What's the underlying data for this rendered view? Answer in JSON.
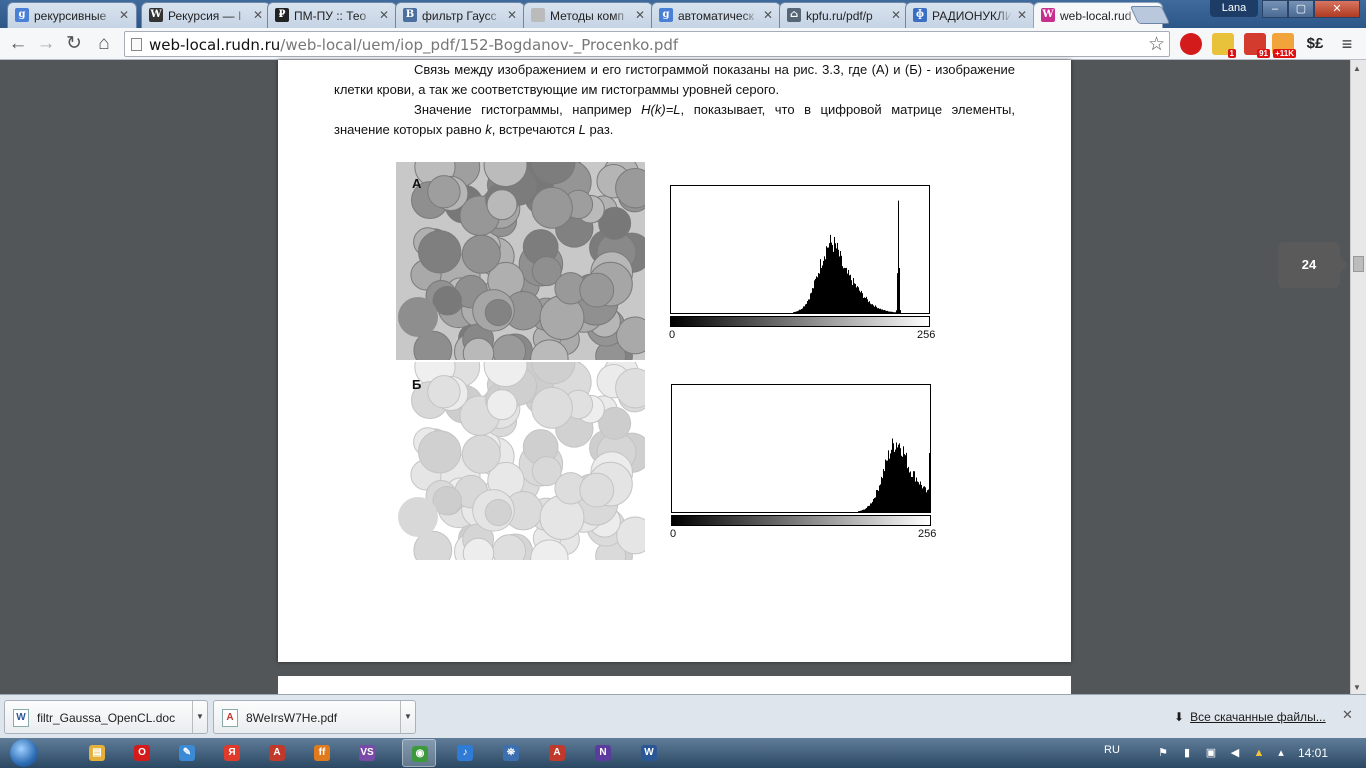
{
  "tabs": [
    {
      "title": "рекурсивные",
      "icon": "google-icon",
      "icon_text": "g",
      "color": "#4a7fd6"
    },
    {
      "title": "Рекурсия — I",
      "icon": "wikipedia-icon",
      "icon_text": "W",
      "color": "#333333"
    },
    {
      "title": "ПМ-ПУ :: Тео",
      "icon": "pmpu-icon",
      "icon_text": "₽",
      "color": "#222222"
    },
    {
      "title": "фильтр Гаусс",
      "icon": "vk-icon",
      "icon_text": "B",
      "color": "#4b6f9e"
    },
    {
      "title": "Методы комп",
      "icon": "page-icon",
      "icon_text": "",
      "color": "#bbbbbb"
    },
    {
      "title": "автоматическ",
      "icon": "google-icon",
      "icon_text": "g",
      "color": "#4a7fd6"
    },
    {
      "title": "kpfu.ru/pdf/p",
      "icon": "university-icon",
      "icon_text": "⌂",
      "color": "#556677"
    },
    {
      "title": "РАДИОНУКЛИ",
      "icon": "phi-icon",
      "icon_text": "ɸ",
      "color": "#3a6fc4"
    },
    {
      "title": "web-local.rud",
      "icon": "rudn-icon",
      "icon_text": "W",
      "color": "#c72f8e"
    }
  ],
  "window": {
    "user": "Lana",
    "minimize": "–",
    "maximize": "▢",
    "close": "✕"
  },
  "toolbar": {
    "back": "←",
    "forward": "→",
    "reload": "↻",
    "home": "⌂",
    "url_host": "web-local.rudn.ru",
    "url_path": "/web-local/uem/iop_pdf/152-Bogdanov-_Procenko.pdf",
    "star": "☆",
    "ext_badges": [
      "1",
      "91",
      "+11K"
    ],
    "ext_currency": "$£",
    "menu": "≡"
  },
  "document": {
    "para1": "Связь между изображением и его гистограммой показаны на рис. 3.3, где (А) и (Б) - изображение клетки крови, а так же соответствующие им гистограммы уровней серого.",
    "para2_a": "Значение гистограммы, например ",
    "para2_hk": "H(k)=L",
    "para2_b": ", показывает, что в цифровой матрице элементы, значение которых равно ",
    "para2_k": "k",
    "para2_c": ", встречаются ",
    "para2_l": "L",
    "para2_d": " раз.",
    "label_a": "А",
    "label_b": "Б",
    "hist_a_min": "0",
    "hist_a_max": "256",
    "hist_b_min": "0",
    "hist_b_max": "256"
  },
  "histograms": {
    "a": {
      "peak_main": 0.62,
      "peak_spike": 0.88
    },
    "b": {
      "peak_main": 0.87,
      "peak_spike": 1.0
    }
  },
  "page_indicator": "24",
  "downloads": {
    "items": [
      {
        "name": "filtr_Gaussa_OpenCL.doc",
        "icon_text": "W",
        "color": "#2b5797"
      },
      {
        "name": "8WeIrsW7He.pdf",
        "icon_text": "A",
        "color": "#c0392b"
      }
    ],
    "all_label": "Все скачанные файлы...",
    "close": "✕"
  },
  "taskbar": {
    "items": [
      {
        "name": "explorer",
        "icon_text": "▤",
        "color": "#e5b03a"
      },
      {
        "name": "opera",
        "icon_text": "O",
        "color": "#d31b1b"
      },
      {
        "name": "paint",
        "icon_text": "✎",
        "color": "#3c8ad6"
      },
      {
        "name": "yandex",
        "icon_text": "Я",
        "color": "#e03a2a"
      },
      {
        "name": "acrobat",
        "icon_text": "A",
        "color": "#c0392b"
      },
      {
        "name": "firefox",
        "icon_text": "ff",
        "color": "#e07a1e"
      },
      {
        "name": "visualstudio",
        "icon_text": "VS",
        "color": "#7a4aa8"
      },
      {
        "name": "chrome",
        "icon_text": "◉",
        "color": "#3c9a3c"
      },
      {
        "name": "itunes",
        "icon_text": "♪",
        "color": "#2f7bd6"
      },
      {
        "name": "maps",
        "icon_text": "⛯",
        "color": "#3c6fb0"
      },
      {
        "name": "pdf-reader",
        "icon_text": "A",
        "color": "#c0392b"
      },
      {
        "name": "onenote",
        "icon_text": "N",
        "color": "#5b3c9e"
      },
      {
        "name": "word",
        "icon_text": "W",
        "color": "#2b5797"
      }
    ],
    "lang": "RU",
    "clock": "14:01"
  }
}
